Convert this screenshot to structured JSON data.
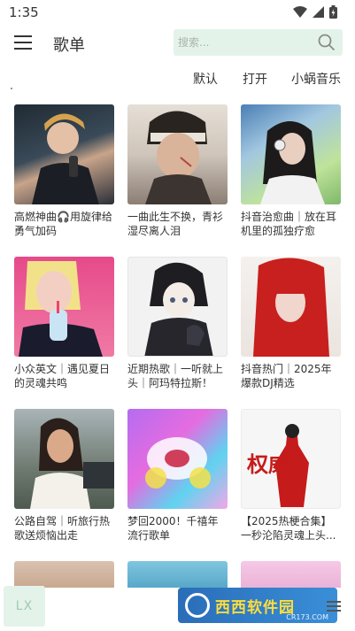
{
  "status": {
    "time": "1:35"
  },
  "header": {
    "title": "歌单",
    "search_placeholder": "搜索..."
  },
  "sort_options": [
    "默认",
    "打开",
    "小蜗音乐"
  ],
  "playlists": [
    {
      "title": "高燃神曲🎧用旋律给勇气加码"
    },
    {
      "title": "一曲此生不换，青衫湿尽离人泪"
    },
    {
      "title": "抖音治愈曲｜放在耳机里的孤独疗愈"
    },
    {
      "title": "小众英文｜遇见夏日的灵魂共鸣"
    },
    {
      "title": "近期热歌｜一听就上头｜阿玛特拉斯！"
    },
    {
      "title": "抖音热门｜2025年爆款DJ精选"
    },
    {
      "title": "公路自驾｜听旅行热歌送烦恼出走"
    },
    {
      "title": "梦回2000！千禧年流行歌单"
    },
    {
      "title": "【2025热梗合集】一秒沦陷灵魂上头..."
    }
  ],
  "bottom": {
    "lx_label": "LX"
  },
  "watermark": {
    "brand": "西西软件园",
    "sub": "CR173.COM"
  },
  "cover_text": {
    "poster": "权威"
  }
}
